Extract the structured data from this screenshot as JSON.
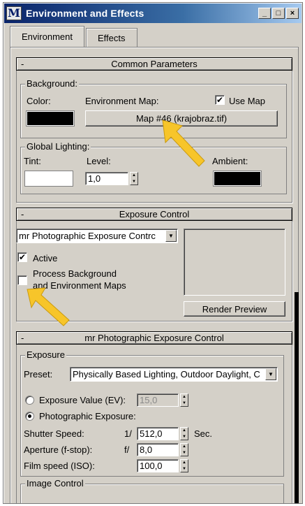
{
  "window": {
    "title": "Environment and Effects",
    "app_icon": "M",
    "minimize": "_",
    "maximize": "□",
    "close": "×"
  },
  "tabs": [
    {
      "label": "Environment"
    },
    {
      "label": "Effects"
    }
  ],
  "common": {
    "header": "Common Parameters",
    "minus": "-",
    "background_group": "Background:",
    "color_label": "Color:",
    "env_map_label": "Environment Map:",
    "use_map_label": "Use Map",
    "use_map_checked": "✔",
    "map_button": "Map #46 (krajobraz.tif)",
    "global_lighting_group": "Global Lighting:",
    "tint_label": "Tint:",
    "level_label": "Level:",
    "level_value": "1,0",
    "ambient_label": "Ambient:",
    "colors": {
      "background": "#000000",
      "tint": "#ffffff",
      "ambient": "#000000"
    }
  },
  "exposure_control": {
    "header": "Exposure Control",
    "minus": "-",
    "dropdown_value": "mr Photographic Exposure Contrc",
    "active_label": "Active",
    "active_checked": "✔",
    "process_bg_label_1": "Process Background",
    "process_bg_label_2": "and Environment Maps",
    "render_preview": "Render Preview"
  },
  "mr_exposure": {
    "header": "mr Photographic Exposure Control",
    "minus": "-",
    "exposure_group": "Exposure",
    "preset_label": "Preset:",
    "preset_value": "Physically Based Lighting, Outdoor Daylight, C",
    "ev_label": "Exposure Value (EV):",
    "ev_value": "15,0",
    "photo_label": "Photographic Exposure:",
    "shutter_label": "Shutter Speed:",
    "shutter_prefix": "1/",
    "shutter_value": "512,0",
    "shutter_unit": "Sec.",
    "aperture_label": "Aperture (f-stop):",
    "aperture_prefix": "f/",
    "aperture_value": "8,0",
    "film_label": "Film speed (ISO):",
    "film_value": "100,0",
    "image_control_group": "Image Control"
  },
  "annotation_color": "#f7c52a"
}
